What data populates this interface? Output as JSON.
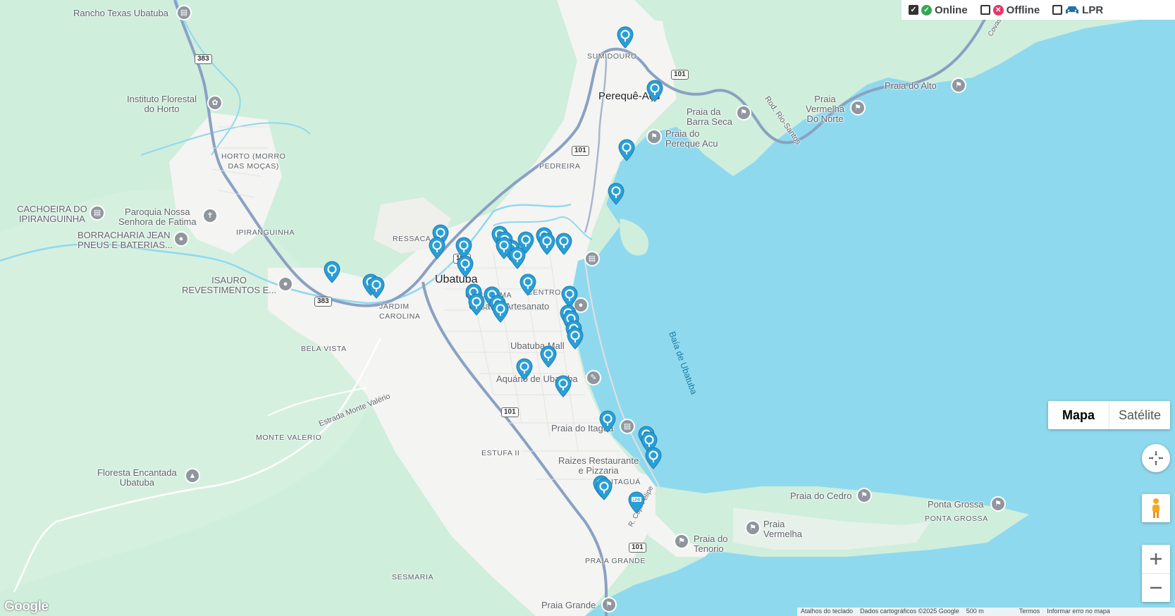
{
  "filters": [
    {
      "label": "Online",
      "checked": true,
      "icon": "check-circle-icon",
      "color": "#34a853"
    },
    {
      "label": "Offline",
      "checked": false,
      "icon": "x-circle-icon",
      "color": "#e8336b"
    },
    {
      "label": "LPR",
      "checked": false,
      "icon": "car-icon",
      "color": "#1f6fb2"
    }
  ],
  "map_type": {
    "map": "Mapa",
    "satellite": "Satélite",
    "selected": "Mapa"
  },
  "labels": {
    "rancho": "Rancho Texas Ubatuba",
    "instituto": "Instituto Florestal\ndo Horto",
    "horto": "HORTO (MORRO\nDAS MOÇAS)",
    "cachoeira": "CACHOEIRA DO\nIPIRANGUINHA",
    "paroquia": "Paroquia Nossa\nSenhora de Fatima",
    "borracharia": "BORRACHARIA JEAN\nPNEUS E BATERIAS...",
    "ipiranguinha": "IPIRANGUINHA",
    "isauro": "ISAURO\nREVESTIMENTOS E...",
    "bela_vista": "BELA VISTA",
    "jardim": "JARDIM\nCAROLINA",
    "ressaca": "RESSACA",
    "ubatuba": "Ubatuba",
    "umuarama": "UMUARAMA",
    "centro": "CENTRO",
    "artesanato": "Casa do Artesanato",
    "mall": "Ubatuba Mall",
    "aquario": "Aquário de Ubatuba",
    "monte_valerio": "MONTE VALERIO",
    "estrada_mv": "Estrada Monte Valério",
    "floresta": "Floresta Encantada\nUbatuba",
    "estufa": "ESTUFA II",
    "sesmaria": "SESMARIA",
    "praia_grande_bairro": "PRAIA GRANDE",
    "praia_grande": "Praia Grande",
    "itagua": "ITAGUÁ",
    "raizes": "Raizes Restaurante\ne Pizzaria",
    "praia_itagua": "Praia do Itaguá",
    "sumidouro": "SUMIDOURO",
    "pereque": "Perequê-Açu",
    "pedreira": "PEDREIRA",
    "barra_seca": "Praia da\nBarra Seca",
    "pereque_acu_praia": "Praia do\nPereque Acu",
    "rod_rio_santos": "Rod. Rio-Santos",
    "praia_vermelha_norte": "Praia\nVermelha\nDo Norte",
    "praia_alto": "Praia do Alto",
    "baia": "Baía de Ubatuba",
    "praia_cedro": "Praia do Cedro",
    "ponta_grossa": "Ponta Grossa",
    "ponta_grossa_bairro": "PONTA GROSSA",
    "praia_vermelha": "Praia\nVermelha",
    "praia_tenorio": "Praia do\nTenorio",
    "r_capfelipe": "R. Cap. Felipe",
    "covas": "Covas"
  },
  "route_shields": [
    "383",
    "383",
    "101",
    "101",
    "101",
    "101",
    "101"
  ],
  "footer": {
    "shortcuts": "Atalhos do teclado",
    "mapdata": "Dados cartográficos ©2025 Google",
    "scale": "500 m",
    "terms": "Termos",
    "report": "Informar erro no mapa"
  },
  "logo": "Google",
  "colors": {
    "land": "#e9f4ea",
    "forest": "#cdeedb",
    "water": "#8fd9ee",
    "urban": "#f4f4f2",
    "highway": "#8aa1c2",
    "pin": "#2a9fd6"
  }
}
